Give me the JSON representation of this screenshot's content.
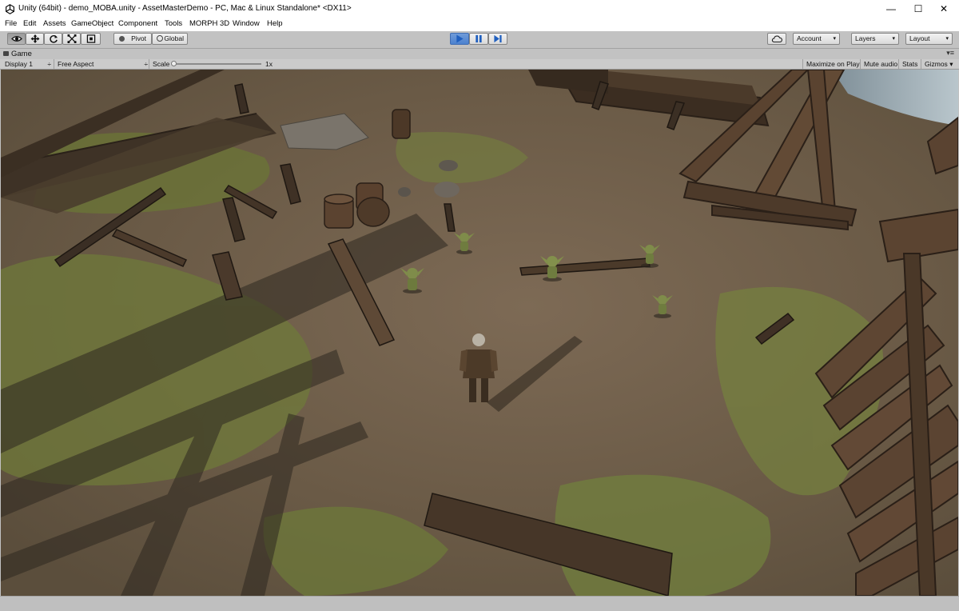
{
  "window": {
    "title": "Unity (64bit) - demo_MOBA.unity - AssetMasterDemo - PC, Mac & Linux Standalone* <DX11>",
    "minimize_glyph": "—",
    "maximize_glyph": "☐",
    "close_glyph": "✕"
  },
  "menu": [
    "File",
    "Edit",
    "Assets",
    "GameObject",
    "Component",
    "Tools",
    "MORPH 3D",
    "Window",
    "Help"
  ],
  "toolbar": {
    "tools": [
      "view-tool",
      "move-tool",
      "rotate-tool",
      "scale-tool",
      "rect-tool"
    ],
    "active_tool": "view-tool",
    "pivot_label": "Pivot",
    "global_label": "Global",
    "playback": {
      "playing": true,
      "paused": false
    },
    "account_label": "Account",
    "layers_label": "Layers",
    "layout_label": "Layout"
  },
  "game_view": {
    "tab_label": "Game",
    "tab_menu": "▾≡",
    "display": "Display 1",
    "aspect": "Free Aspect",
    "scale_label": "Scale",
    "scale_value": "1x",
    "scale_fraction": 0.0,
    "maximize_on_play": "Maximize on Play",
    "mute_audio": "Mute audio",
    "stats": "Stats",
    "gizmos": "Gizmos"
  },
  "colors": {
    "play_active": "#4d82cf",
    "icon_blue": "#1f5fbf",
    "ground": "#6b5d4a",
    "grass": "#7f8a3e",
    "wood": "#4a3525"
  }
}
